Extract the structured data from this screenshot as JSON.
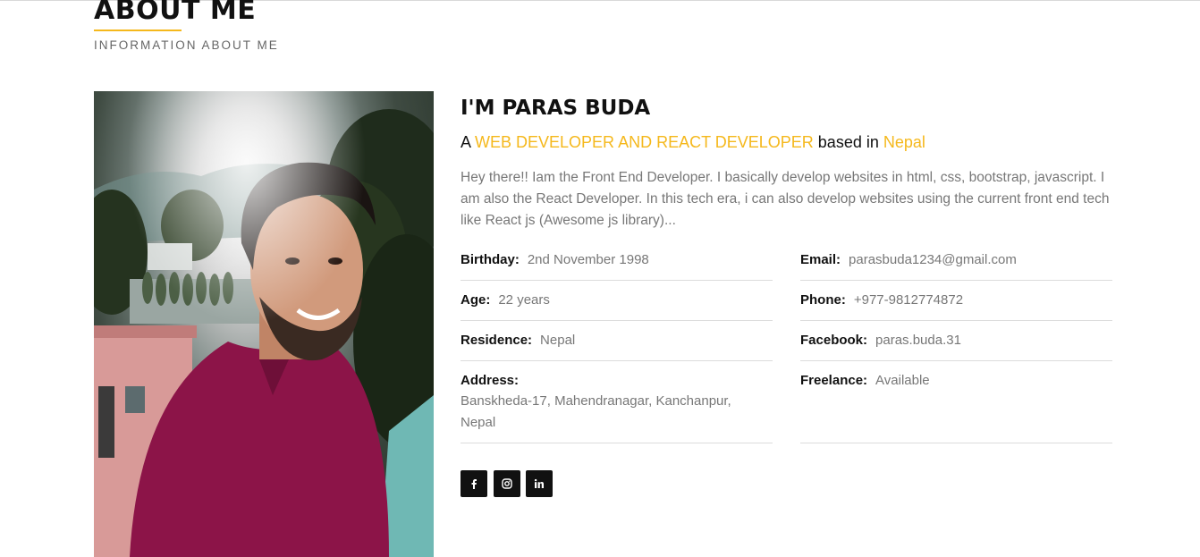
{
  "section": {
    "title": "ABOUT ME",
    "subtitle": "INFORMATION ABOUT ME"
  },
  "profile": {
    "heading": "I'M PARAS BUDA",
    "tagline_prefix": "A ",
    "tagline_role": "WEB DEVELOPER AND REACT DEVELOPER",
    "tagline_mid": " based in ",
    "tagline_place": "Nepal",
    "intro": "Hey there!! Iam the Front End Developer. I basically develop websites in html, css, bootstrap, javascript. I am also the React Developer. In this tech era, i can also develop websites using the current front end tech like React js (Awesome js library)..."
  },
  "details": {
    "birthday": {
      "label": "Birthday:",
      "value": "2nd November 1998"
    },
    "age": {
      "label": "Age:",
      "value": "22 years"
    },
    "residence": {
      "label": "Residence:",
      "value": "Nepal"
    },
    "address": {
      "label": "Address:",
      "value": "Banskheda-17, Mahendranagar, Kanchanpur, Nepal"
    },
    "email": {
      "label": "Email:",
      "value": "parasbuda1234@gmail.com"
    },
    "phone": {
      "label": "Phone:",
      "value": "+977-9812774872"
    },
    "facebook": {
      "label": "Facebook:",
      "value": "paras.buda.31"
    },
    "freelance": {
      "label": "Freelance:",
      "value": "Available"
    }
  },
  "social": [
    {
      "icon": "facebook-icon"
    },
    {
      "icon": "instagram-icon"
    },
    {
      "icon": "linkedin-icon"
    }
  ],
  "colors": {
    "accent": "#f5b81c",
    "text_dark": "#111111",
    "text_muted": "#777777",
    "divider": "#dcdcdc"
  }
}
